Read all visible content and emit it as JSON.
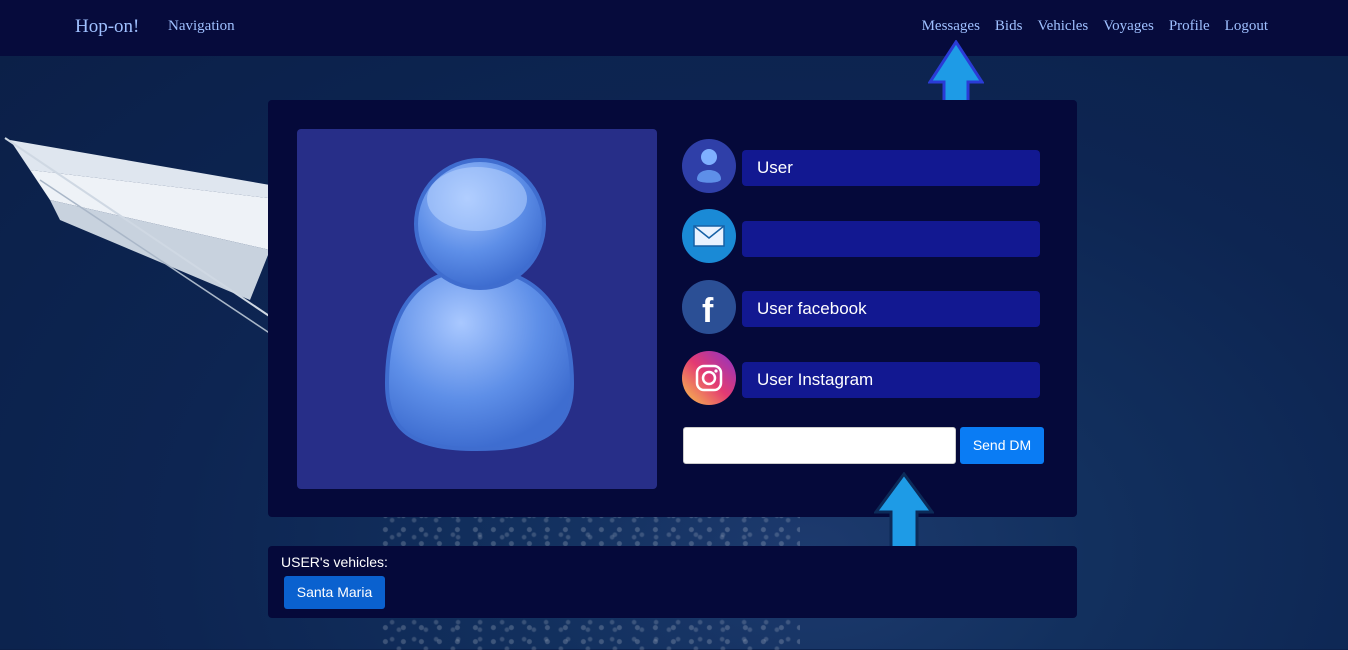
{
  "nav": {
    "brand": "Hop-on!",
    "title": "Navigation",
    "links": [
      "Messages",
      "Bids",
      "Vehicles",
      "Voyages",
      "Profile",
      "Logout"
    ]
  },
  "profile": {
    "username": "User",
    "email": "",
    "facebook": "User facebook",
    "instagram": "User Instagram",
    "dm_input_value": "",
    "dm_button": "Send DM"
  },
  "vehicles": {
    "label": "USER's vehicles:",
    "items": [
      "Santa Maria"
    ]
  },
  "icons": {
    "user_row": "user-icon",
    "email_row": "envelope-icon",
    "facebook_row": "facebook-icon",
    "instagram_row": "instagram-icon",
    "annotations": "up-arrow-icon"
  },
  "colors": {
    "navbar": "#060b3c",
    "card": "#05093a",
    "field": "#121891",
    "button": "#0a7cf4",
    "vehicle_button": "#0a61cf"
  }
}
